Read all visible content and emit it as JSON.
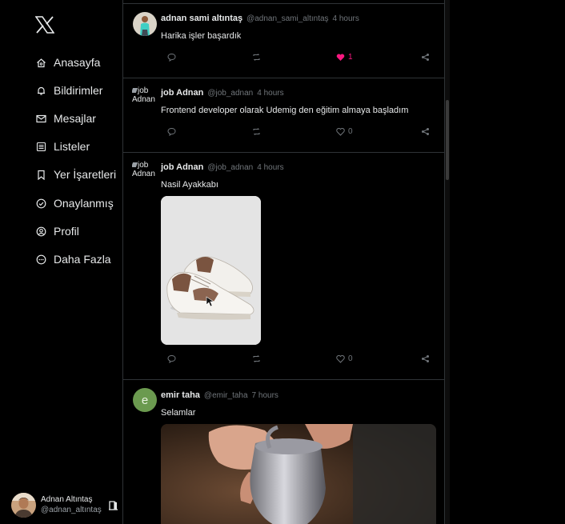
{
  "sidebar": {
    "nav": [
      {
        "label": "Anasayfa",
        "icon": "home-icon"
      },
      {
        "label": "Bildirimler",
        "icon": "bell-icon"
      },
      {
        "label": "Mesajlar",
        "icon": "mail-icon"
      },
      {
        "label": "Listeler",
        "icon": "list-icon"
      },
      {
        "label": "Yer İşaretleri",
        "icon": "bookmark-icon"
      },
      {
        "label": "Onaylanmış",
        "icon": "verified-icon"
      },
      {
        "label": "Profil",
        "icon": "profile-icon"
      },
      {
        "label": "Daha Fazla",
        "icon": "more-icon"
      }
    ],
    "profile": {
      "name": "Adnan Altıntaş",
      "handle": "@adnan_altıntaş"
    }
  },
  "feed": {
    "tweets": [
      {
        "name": "adnan sami altıntaş",
        "handle": "@adnan_sami_altıntaş",
        "time": "4 hours",
        "text": "Harika işler başardık",
        "likes": "1",
        "liked": true
      },
      {
        "name": "job Adnan",
        "handle": "@job_adnan",
        "time": "4 hours",
        "avatar_alt": "job Adnan",
        "text": "Frontend developer olarak Udemig den eğitim almaya başladım",
        "likes": "0",
        "liked": false
      },
      {
        "name": "job Adnan",
        "handle": "@job_adnan",
        "time": "4 hours",
        "avatar_alt": "job Adnan",
        "text": "Nasil Ayakkabı",
        "likes": "0",
        "liked": false
      },
      {
        "name": "emir taha",
        "handle": "@emir_taha",
        "time": "7 hours",
        "avatar_letter": "e",
        "text": "Selamlar"
      }
    ]
  },
  "colors": {
    "like": "#f91880",
    "avatar_e": "#6b9a4f",
    "border": "#2f3336"
  }
}
